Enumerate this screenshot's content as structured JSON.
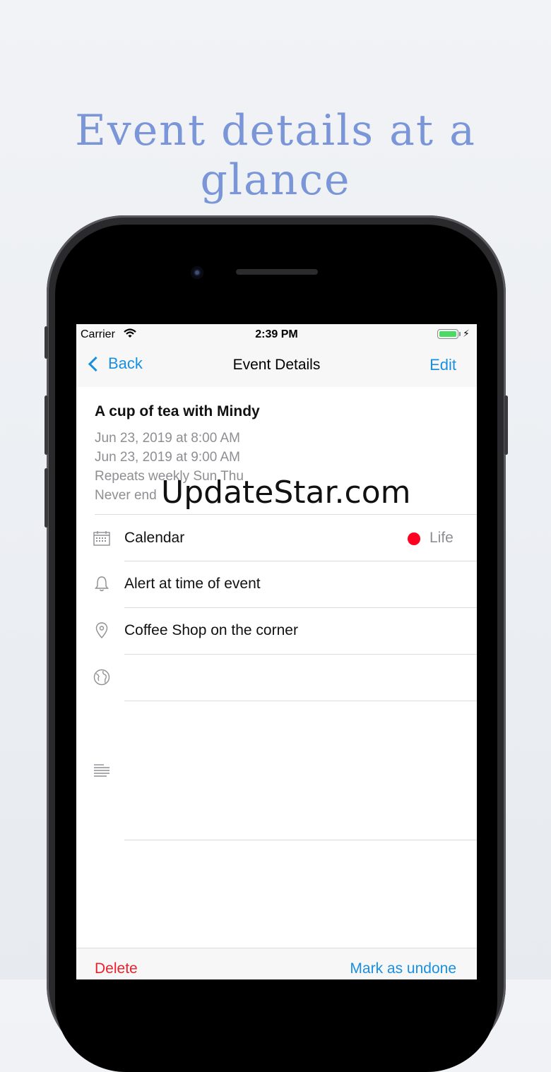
{
  "headline": "Event details at a glance",
  "status_bar": {
    "carrier": "Carrier",
    "time": "2:39 PM"
  },
  "nav": {
    "back_label": "Back",
    "title": "Event Details",
    "edit_label": "Edit"
  },
  "event": {
    "title": "A cup of tea with Mindy",
    "start": "Jun 23, 2019 at 8:00 AM",
    "end": "Jun 23, 2019 at 9:00 AM",
    "repeat": "Repeats weekly Sun Thu",
    "ends": "Never end"
  },
  "rows": {
    "calendar_label": "Calendar",
    "calendar_value": "Life",
    "calendar_color": "#ff0020",
    "alert": "Alert at time of event",
    "location": "Coffee Shop on the corner"
  },
  "toolbar": {
    "delete_label": "Delete",
    "mark_label": "Mark as undone"
  },
  "watermark": "UpdateStar.com",
  "colors": {
    "accent": "#1a8fe0",
    "destructive": "#e8232f",
    "headline": "#7a96d8"
  }
}
